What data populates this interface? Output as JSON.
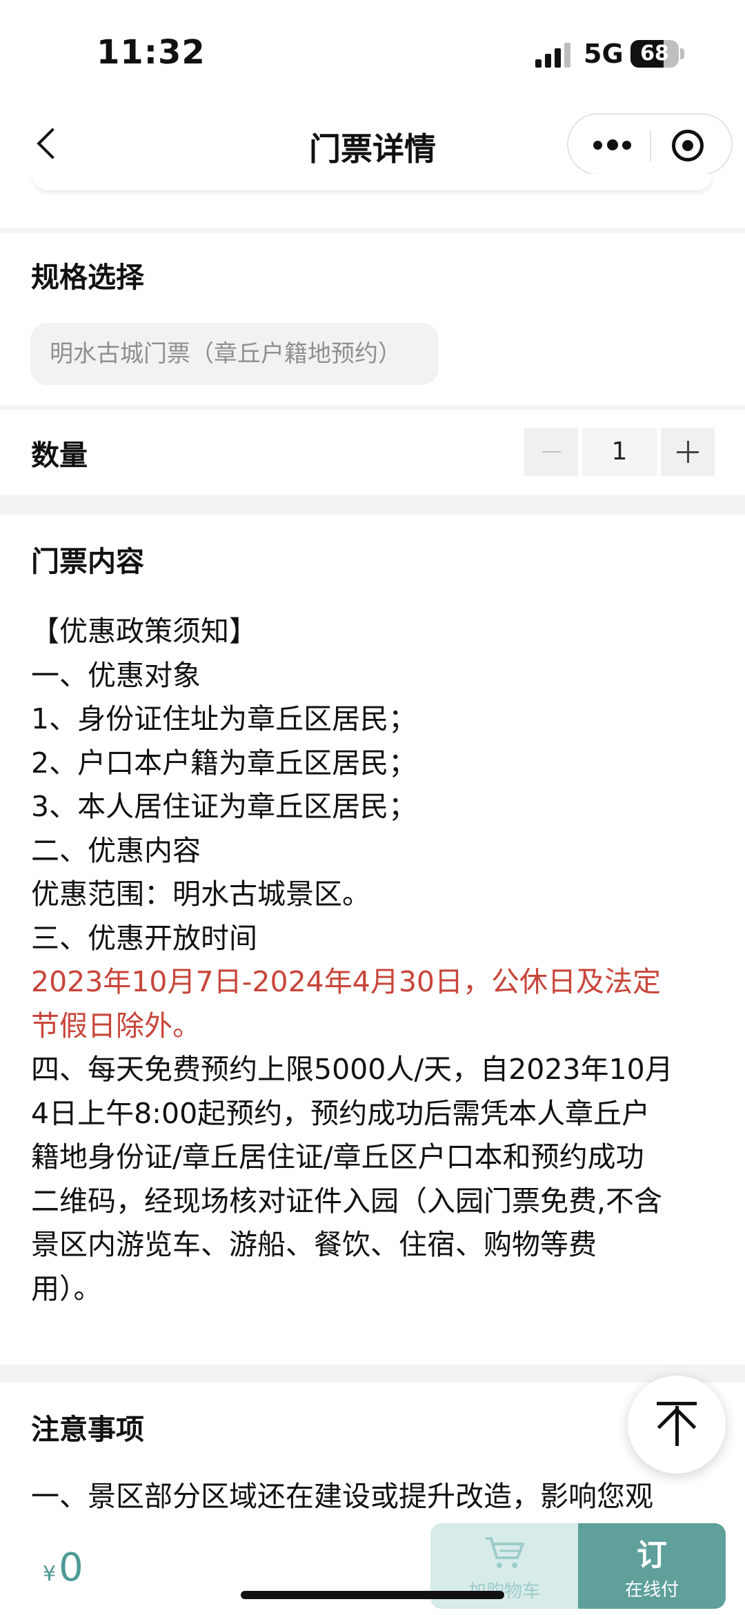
{
  "status_bar": {
    "time": "11:32",
    "network": "5G",
    "battery": "68"
  },
  "nav": {
    "title": "门票详情"
  },
  "spec": {
    "title": "规格选择",
    "option": "明水古城门票（章丘户籍地预约）"
  },
  "quantity": {
    "title": "数量",
    "value": "1"
  },
  "ticket_content": {
    "title": "门票内容",
    "lines": [
      "【优惠政策须知】",
      "一、优惠对象",
      "1、身份证住址为章丘区居民；",
      "2、户口本户籍为章丘区居民；",
      "3、本人居住证为章丘区居民；",
      "二、优惠内容",
      "优惠范围：明水古城景区。",
      "三、优惠开放时间",
      "2023年10月7日-2024年4月30日，公休日及法定",
      "节假日除外。",
      "四、每天免费预约上限5000人/天，自2023年10月",
      "4日上午8:00起预约，预约成功后需凭本人章丘户",
      "籍地身份证/章丘居住证/章丘区户口本和预约成功",
      "二维码，经现场核对证件入园（入园门票免费,不含",
      "景区内游览车、游船、餐饮、住宿、购物等费",
      "用）。"
    ]
  },
  "notice": {
    "title": "注意事项",
    "line1": "一、景区部分区域还在建设或提升改造，影响您观"
  },
  "bottom_bar": {
    "currency": "¥",
    "price": "0",
    "cart_label": "加购物车",
    "order_char": "订",
    "order_label": "在线付"
  },
  "colors": {
    "accent": "#5fa09b",
    "highlight_red": "#c8453a"
  }
}
